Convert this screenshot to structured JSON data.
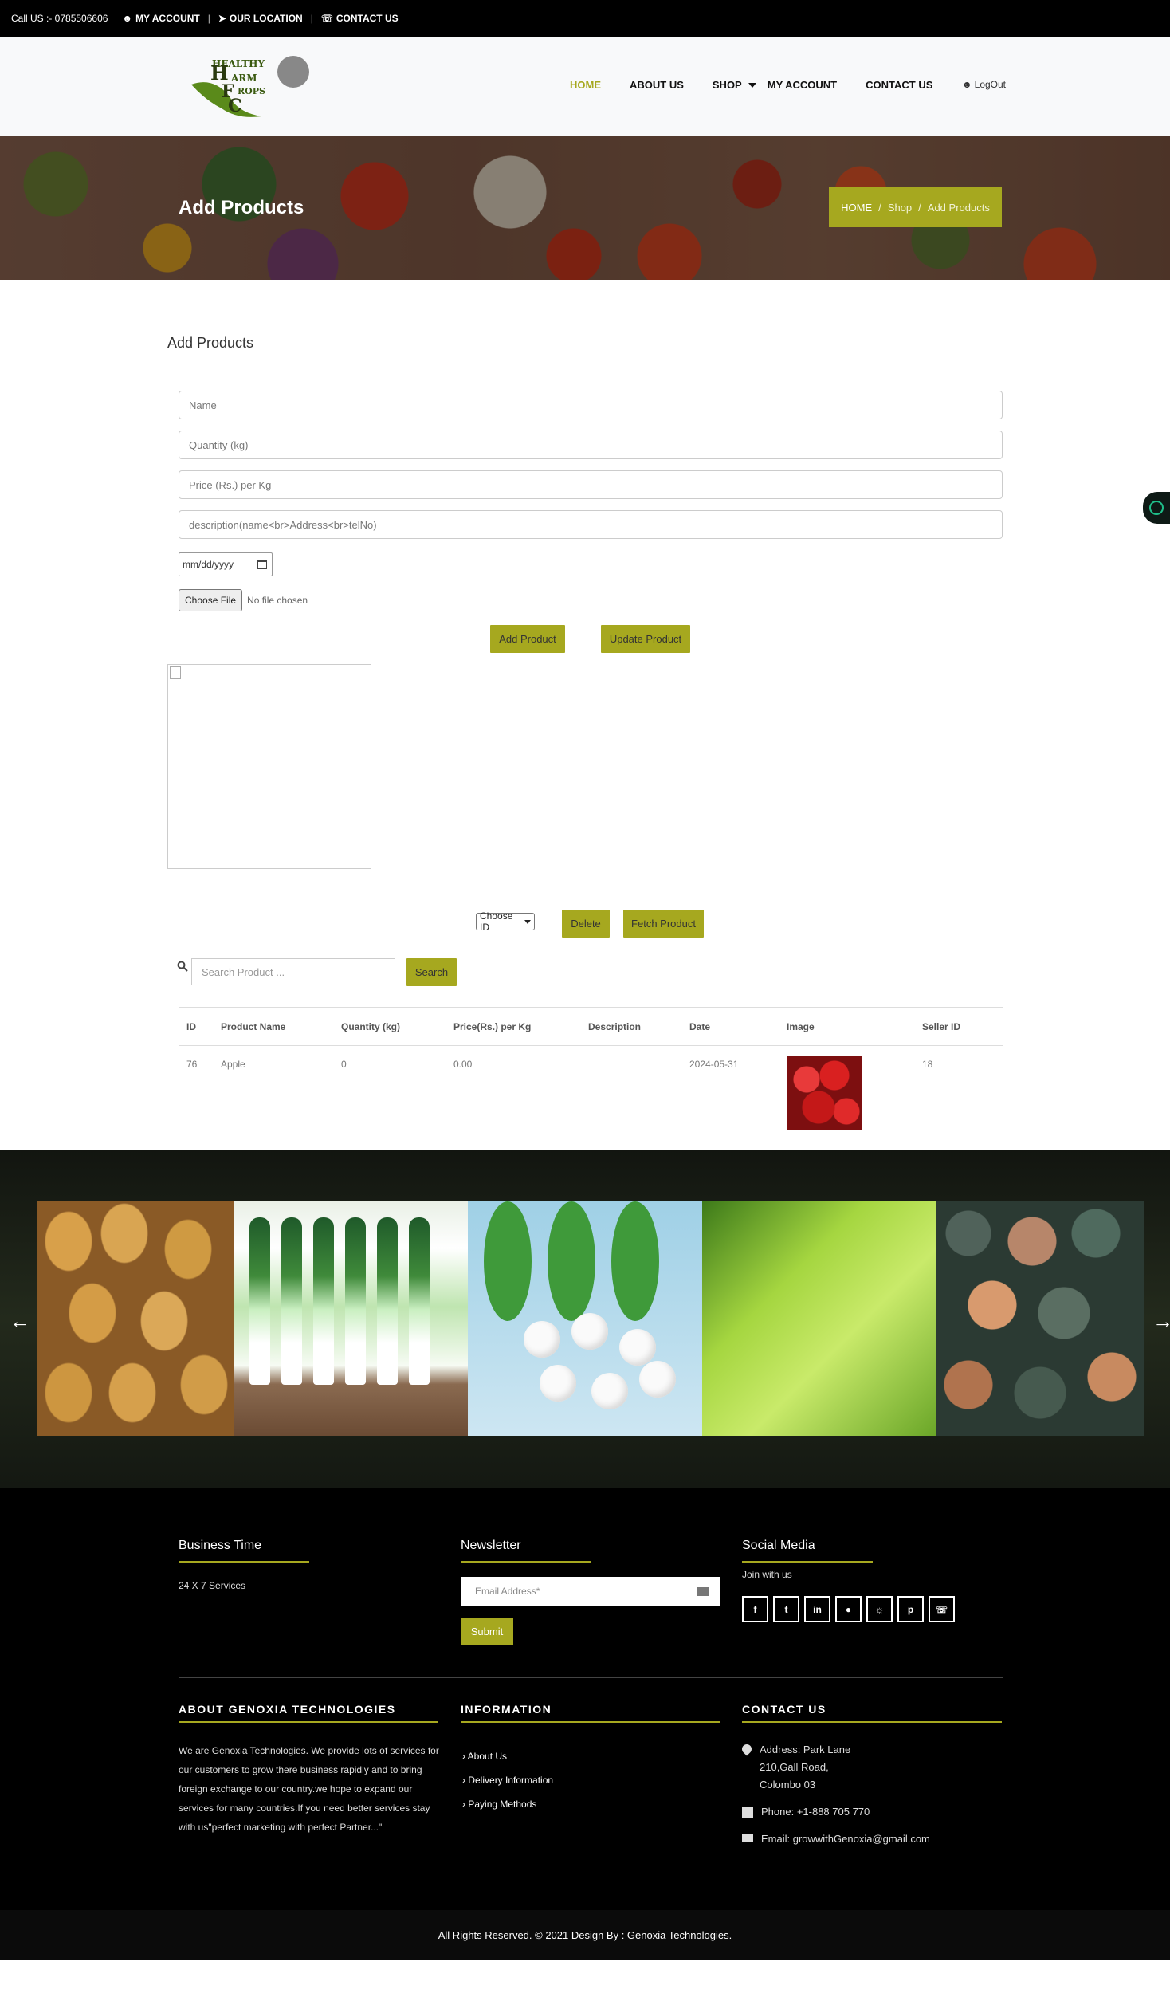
{
  "topbar": {
    "phone": "Call US :- 0785506606",
    "my_account": "MY ACCOUNT",
    "our_location": "OUR LOCATION",
    "contact_us": "CONTACT US"
  },
  "header": {
    "logo_text": "HEALTHY FARM CROPS",
    "nav": {
      "home": "HOME",
      "about": "ABOUT US",
      "shop": "SHOP",
      "my_account": "MY ACCOUNT",
      "contact": "CONTACT US"
    },
    "logout": "LogOut"
  },
  "banner": {
    "title": "Add Products",
    "breadcrumb": {
      "home": "HOME",
      "sep": "/",
      "shop": "Shop",
      "current": "Add Products"
    }
  },
  "form": {
    "section_title": "Add Products",
    "name_placeholder": "Name",
    "quantity_placeholder": "Quantity (kg)",
    "price_placeholder": "Price (Rs.) per Kg",
    "description_placeholder": "description(name<br>Address<br>telNo)",
    "date_placeholder": "mm/dd/yyyy",
    "choose_file": "Choose File",
    "no_file": "No file chosen",
    "add_button": "Add Product",
    "update_button": "Update Product"
  },
  "actions": {
    "select_value": "Choose ID",
    "delete_button": "Delete",
    "fetch_button": "Fetch Product",
    "search_placeholder": "Search Product ...",
    "search_button": "Search"
  },
  "table": {
    "headers": [
      "ID",
      "Product Name",
      "Quantity (kg)",
      "Price(Rs.) per Kg",
      "Description",
      "Date",
      "Image",
      "Seller ID"
    ],
    "rows": [
      {
        "id": "76",
        "name": "Apple",
        "quantity": "0",
        "price": "0.00",
        "description": "",
        "date": "2024-05-31",
        "seller_id": "18"
      }
    ]
  },
  "footer": {
    "business_time_title": "Business Time",
    "business_time_text": "24 X 7 Services",
    "newsletter_title": "Newsletter",
    "email_placeholder": "Email Address*",
    "submit": "Submit",
    "social_title": "Social Media",
    "social_subtitle": "Join with us",
    "about_title": "ABOUT GENOXIA TECHNOLOGIES",
    "about_text": "We are Genoxia Technologies. We provide lots of services for our customers to grow there business rapidly and to bring foreign exchange to our country.we hope to expand our services for many countries.If you need better services stay with us\"perfect marketing with perfect Partner...\"",
    "info_title": "INFORMATION",
    "info_links": [
      "About Us",
      "Delivery Information",
      "Paying Methods"
    ],
    "contact_title": "CONTACT US",
    "address_line1": "Address: Park Lane",
    "address_line2": "210,Gall Road,",
    "address_line3": "Colombo 03",
    "phone": "Phone: +1-888 705 770",
    "email": "Email: growwithGenoxia@gmail.com",
    "copyright": "All Rights Reserved. © 2021 Design By : Genoxia Technologies."
  },
  "colors": {
    "accent": "#a6a81f",
    "dark": "#000000"
  }
}
